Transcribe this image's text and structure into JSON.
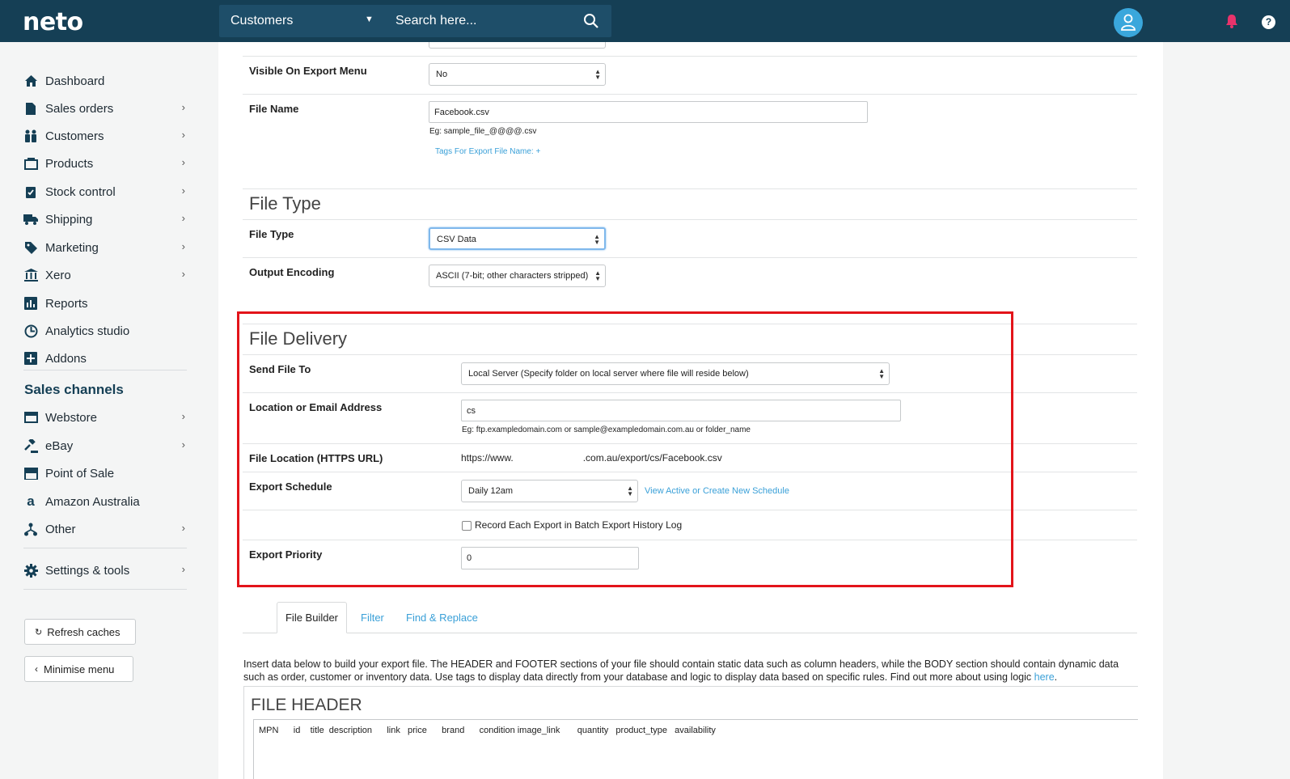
{
  "topbar": {
    "logo": "neto",
    "search_scope": "Customers",
    "search_placeholder": "Search here..."
  },
  "sidebar": {
    "items": [
      {
        "label": "Dashboard",
        "icon": "home-icon",
        "chevron": false
      },
      {
        "label": "Sales orders",
        "icon": "document-icon",
        "chevron": true
      },
      {
        "label": "Customers",
        "icon": "people-icon",
        "chevron": true
      },
      {
        "label": "Products",
        "icon": "box-icon",
        "chevron": true
      },
      {
        "label": "Stock control",
        "icon": "clipboard-check-icon",
        "chevron": true
      },
      {
        "label": "Shipping",
        "icon": "truck-icon",
        "chevron": true
      },
      {
        "label": "Marketing",
        "icon": "tag-icon",
        "chevron": true
      },
      {
        "label": "Xero",
        "icon": "bank-icon",
        "chevron": true
      },
      {
        "label": "Reports",
        "icon": "bar-chart-icon",
        "chevron": false
      },
      {
        "label": "Analytics studio",
        "icon": "analytics-icon",
        "chevron": false
      },
      {
        "label": "Addons",
        "icon": "plus-square-icon",
        "chevron": false
      }
    ],
    "channels_heading": "Sales channels",
    "channels": [
      {
        "label": "Webstore",
        "icon": "browser-icon",
        "chevron": true
      },
      {
        "label": "eBay",
        "icon": "gavel-icon",
        "chevron": true
      },
      {
        "label": "Point of Sale",
        "icon": "store-icon",
        "chevron": false
      },
      {
        "label": "Amazon Australia",
        "icon": "amazon-icon",
        "chevron": false
      },
      {
        "label": "Other",
        "icon": "sitemap-icon",
        "chevron": true
      }
    ],
    "settings": {
      "label": "Settings & tools",
      "icon": "gear-icon",
      "chevron": true
    },
    "refresh_label": "Refresh caches",
    "minimise_label": "Minimise menu"
  },
  "form": {
    "visible_on_export_menu": {
      "label": "Visible On Export Menu",
      "value": "No"
    },
    "file_name": {
      "label": "File Name",
      "value": "Facebook.csv",
      "hint": "Eg: sample_file_@@@@.csv",
      "tags_link": "Tags For Export File Name: +"
    },
    "file_type_section": "File Type",
    "file_type": {
      "label": "File Type",
      "value": "CSV Data"
    },
    "output_encoding": {
      "label": "Output Encoding",
      "value": "ASCII (7-bit; other characters stripped)"
    },
    "file_delivery_section": "File Delivery",
    "send_file_to": {
      "label": "Send File To",
      "value": "Local Server (Specify folder on local server where file will reside below)"
    },
    "location": {
      "label": "Location or Email Address",
      "value": "cs",
      "hint": "Eg: ftp.exampledomain.com or sample@exampledomain.com.au or folder_name"
    },
    "file_location": {
      "label": "File Location (HTTPS URL)",
      "url_start": "https://www.",
      "url_end": ".com.au/export/cs/Facebook.csv"
    },
    "export_schedule": {
      "label": "Export Schedule",
      "value": "Daily 12am",
      "link": "View Active or Create New Schedule"
    },
    "record_history": {
      "label": "Record Each Export in Batch Export History Log",
      "checked": false
    },
    "export_priority": {
      "label": "Export Priority",
      "value": "0"
    }
  },
  "builder": {
    "tabs": [
      "File Builder",
      "Filter",
      "Find & Replace"
    ],
    "active_tab": "File Builder",
    "description": "Insert data below to build your export file. The HEADER and FOOTER sections of your file should contain static data such as column headers, while the BODY section should contain dynamic data such as order, customer or inventory data. Use tags to display data directly from your database and logic to display data based on specific rules. Find out more about using logic ",
    "description_link": "here",
    "file_header_title": "FILE HEADER",
    "file_header_content": "MPN      id    title  description      link   price      brand      condition image_link       quantity   product_type   availability"
  },
  "colors": {
    "topbar": "#153f55",
    "accent": "#3aa0d8",
    "highlight_border": "#e3141a",
    "bell": "#e8336b"
  }
}
